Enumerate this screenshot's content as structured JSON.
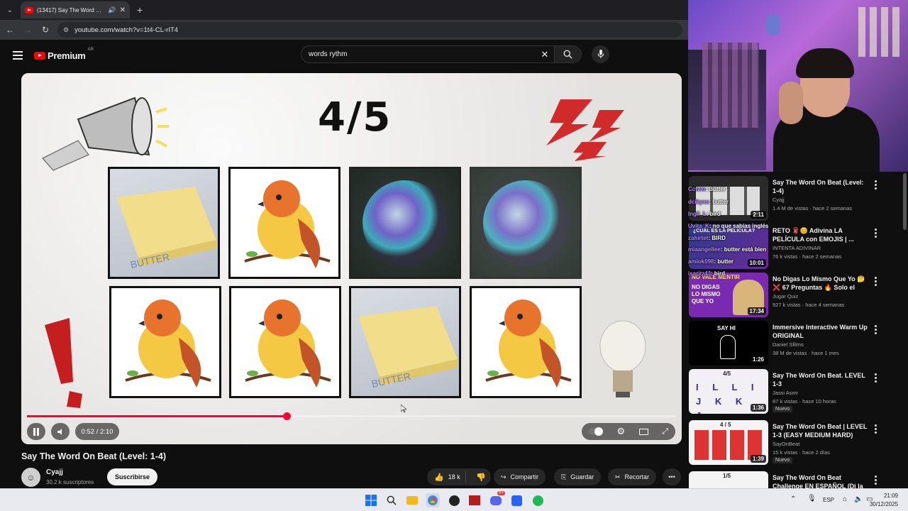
{
  "browser": {
    "tab_title": "(13417) Say The Word On Beat",
    "url": "youtube.com/watch?v=1t4-CL-rIT4",
    "new_tab": "+",
    "tab_audio": "🔊",
    "tab_close": "✕"
  },
  "youtube": {
    "logo_text": "Premium",
    "logo_region": "AR",
    "search_query": "words rythm",
    "search_clear": "✕"
  },
  "video": {
    "slide_text": "4/5",
    "progress": 0.4,
    "time": "0:52 / 2:10",
    "title": "Say The Word On Beat (Level: 1-4)"
  },
  "channel": {
    "name": "Cyajj",
    "subscribers": "30.2 k suscriptores",
    "subscribe_label": "Suscribirse",
    "avatar_letter": "☺"
  },
  "actions": {
    "likes": "18 k",
    "share": "Compartir",
    "save": "Guardar",
    "clip": "Recortar"
  },
  "chat": [
    {
      "user": "Cctvio",
      "msg": ": Butter"
    },
    {
      "user": "dcikyxs",
      "msg": ": butter"
    },
    {
      "user": "Ingli_L",
      "msg": ": bird"
    },
    {
      "user": "Uvita_K",
      "msg": ": no que sabías inglés"
    },
    {
      "user": "zahirtet",
      "msg": ": BIRD"
    },
    {
      "user": "miaangellee",
      "msg": ": butter está bien"
    },
    {
      "user": "amiok098",
      "msg": ": butter"
    },
    {
      "user": "isaritz43",
      "msg": ": bird"
    }
  ],
  "recommendations": [
    {
      "title": "Say The Word On Beat (Level: 1-4)",
      "channel": "Cyajj",
      "meta": "1.4 M de vistas · hace 2 semanas",
      "duration": "2:11",
      "badge": ""
    },
    {
      "title": "RETO 🧣😊 Adivina LA PELÍCULA con EMOJIS | ...",
      "channel": "INTENTA ADIVINAR",
      "meta": "76 k vistas · hace 2 semanas",
      "duration": "10:01",
      "badge": ""
    },
    {
      "title": "No Digas Lo Mismo Que Yo 🤔 ❌ 67 Preguntas 🔥 Solo el 5%...",
      "channel": "Jugar Quiz",
      "meta": "927 k vistas · hace 4 semanas",
      "duration": "17:34",
      "badge": ""
    },
    {
      "title": "Immersive Interactive Warm Up ORIGINAL",
      "channel": "Daniel Sfilms",
      "meta": "38 M de vistas · hace 1 mes",
      "duration": "1:26",
      "badge": ""
    },
    {
      "title": "Say The Word On Beat. LEVEL 1-3",
      "channel": "Jassi Asmr",
      "meta": "87 k vistas · hace 10 horas",
      "duration": "1:36",
      "badge": "Nuevo"
    },
    {
      "title": "Say The Word On Beat | LEVEL 1-3 (EASY MEDIUM HARD)",
      "channel": "SayOnBeat",
      "meta": "15 k vistas · hace 2 días",
      "duration": "1:39",
      "badge": "Nuevo"
    },
    {
      "title": "Say The Word On Beat Challenge EN ESPAÑOL (Di la ...",
      "channel": "",
      "meta": "",
      "duration": "",
      "badge": ""
    }
  ],
  "thumb_text": {
    "t1_overlay": "¿CUÁL ES LA PELÍCULA?",
    "t2_big": "NO VALE MENTIR",
    "t2_sub": "NO DIGAS LO MISMO QUE YO",
    "t3": "SAY HI",
    "t4_frac": "4/5",
    "t4_letters": "I L L I J K K J",
    "t5_frac": "4 / 5",
    "t6_frac": "1/5"
  },
  "taskbar": {
    "lang": "ESP",
    "time": "21:09",
    "date": "30/12/2025",
    "notif_count": "9+"
  }
}
